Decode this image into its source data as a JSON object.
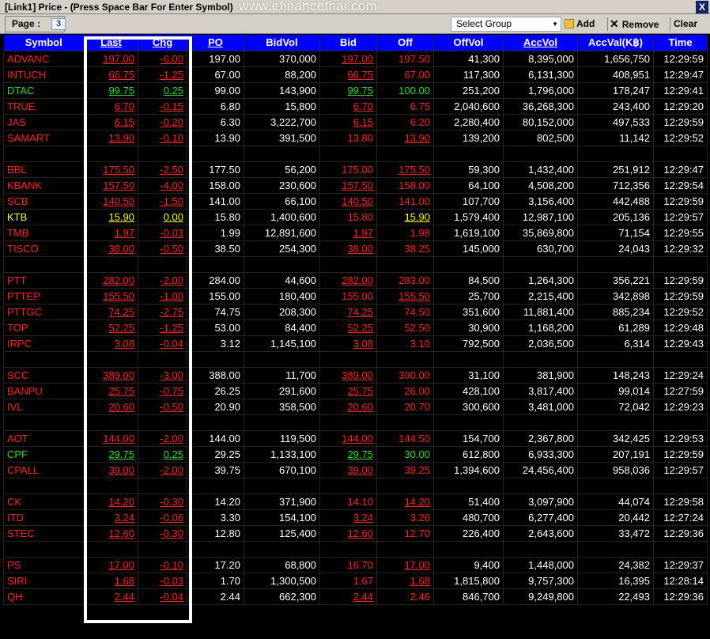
{
  "window": {
    "title": "[Link1] Price  - (Press Space Bar For Enter Symbol)",
    "watermark": "www.efinancethai.com",
    "close_label": "X"
  },
  "toolbar": {
    "page_label": "Page :",
    "page_value": "3",
    "group_placeholder": "Select Group",
    "add_label": "Add",
    "remove_label": "Remove",
    "clear_label": "Clear"
  },
  "columns": [
    "Symbol",
    "Last",
    "Chg",
    "PO",
    "BidVol",
    "Bid",
    "Off",
    "OffVol",
    "AccVol",
    "AccVal(K฿)",
    "Time"
  ],
  "rows": [
    {
      "symbol": "ADVANC",
      "c": "r",
      "last": "197.00",
      "lc": "r",
      "chg": "-6.00",
      "cc": "r",
      "po": "197.00",
      "bidvol": "370,000",
      "bid": "197.00",
      "bc": "r",
      "bu": 1,
      "off": "197.50",
      "oc": "r",
      "ou": 0,
      "offvol": "41,300",
      "accvol": "8,395,000",
      "accval": "1,656,750",
      "time": "12:29:59"
    },
    {
      "symbol": "INTUCH",
      "c": "r",
      "last": "66.75",
      "lc": "r",
      "chg": "-1.25",
      "cc": "r",
      "po": "67.00",
      "bidvol": "88,200",
      "bid": "66.75",
      "bc": "r",
      "bu": 1,
      "off": "67.00",
      "oc": "r",
      "ou": 0,
      "offvol": "117,300",
      "accvol": "6,131,300",
      "accval": "408,951",
      "time": "12:29:47"
    },
    {
      "symbol": "DTAC",
      "c": "g",
      "last": "99.75",
      "lc": "g",
      "chg": "0.25",
      "cc": "g",
      "po": "99.00",
      "bidvol": "143,900",
      "bid": "99.75",
      "bc": "g",
      "bu": 1,
      "off": "100.00",
      "oc": "g",
      "ou": 0,
      "offvol": "251,200",
      "accvol": "1,796,000",
      "accval": "178,247",
      "time": "12:29:41"
    },
    {
      "symbol": "TRUE",
      "c": "r",
      "last": "6.70",
      "lc": "r",
      "chg": "-0.15",
      "cc": "r",
      "po": "6.80",
      "bidvol": "15,800",
      "bid": "6.70",
      "bc": "r",
      "bu": 1,
      "off": "6.75",
      "oc": "r",
      "ou": 0,
      "offvol": "2,040,600",
      "accvol": "36,268,300",
      "accval": "243,400",
      "time": "12:29:20"
    },
    {
      "symbol": "JAS",
      "c": "r",
      "last": "6.15",
      "lc": "r",
      "chg": "-0.20",
      "cc": "r",
      "po": "6.30",
      "bidvol": "3,222,700",
      "bid": "6.15",
      "bc": "r",
      "bu": 1,
      "off": "6.20",
      "oc": "r",
      "ou": 0,
      "offvol": "2,280,400",
      "accvol": "80,152,000",
      "accval": "497,533",
      "time": "12:29:59"
    },
    {
      "symbol": "SAMART",
      "c": "r",
      "last": "13.90",
      "lc": "r",
      "chg": "-0.10",
      "cc": "r",
      "po": "13.90",
      "bidvol": "391,500",
      "bid": "13.80",
      "bc": "r",
      "bu": 0,
      "off": "13.90",
      "oc": "r",
      "ou": 1,
      "offvol": "139,200",
      "accvol": "802,500",
      "accval": "11,142",
      "time": "12:29:52"
    },
    {
      "blank": true
    },
    {
      "symbol": "BBL",
      "c": "r",
      "last": "175.50",
      "lc": "r",
      "chg": "-2.50",
      "cc": "r",
      "po": "177.50",
      "bidvol": "56,200",
      "bid": "175.00",
      "bc": "r",
      "bu": 0,
      "off": "175.50",
      "oc": "r",
      "ou": 1,
      "offvol": "59,300",
      "accvol": "1,432,400",
      "accval": "251,912",
      "time": "12:29:47"
    },
    {
      "symbol": "KBANK",
      "c": "r",
      "last": "157.50",
      "lc": "r",
      "chg": "-4.00",
      "cc": "r",
      "po": "158.00",
      "bidvol": "230,600",
      "bid": "157.50",
      "bc": "r",
      "bu": 1,
      "off": "158.00",
      "oc": "r",
      "ou": 0,
      "offvol": "64,100",
      "accvol": "4,508,200",
      "accval": "712,356",
      "time": "12:29:54"
    },
    {
      "symbol": "SCB",
      "c": "r",
      "last": "140.50",
      "lc": "r",
      "chg": "-1.50",
      "cc": "r",
      "po": "141.00",
      "bidvol": "66,100",
      "bid": "140.50",
      "bc": "r",
      "bu": 1,
      "off": "141.00",
      "oc": "r",
      "ou": 0,
      "offvol": "107,700",
      "accvol": "3,156,400",
      "accval": "442,488",
      "time": "12:29:59"
    },
    {
      "symbol": "KTB",
      "c": "y",
      "last": "15.90",
      "lc": "y",
      "chg": "0.00",
      "cc": "y",
      "po": "15.80",
      "bidvol": "1,400,600",
      "bid": "15.80",
      "bc": "r",
      "bu": 0,
      "off": "15.90",
      "oc": "y",
      "ou": 1,
      "offvol": "1,579,400",
      "accvol": "12,987,100",
      "accval": "205,136",
      "time": "12:29:57"
    },
    {
      "symbol": "TMB",
      "c": "r",
      "last": "1.97",
      "lc": "r",
      "chg": "-0.03",
      "cc": "r",
      "po": "1.99",
      "bidvol": "12,891,600",
      "bid": "1.97",
      "bc": "r",
      "bu": 1,
      "off": "1.98",
      "oc": "r",
      "ou": 0,
      "offvol": "1,619,100",
      "accvol": "35,869,800",
      "accval": "71,154",
      "time": "12:29:55"
    },
    {
      "symbol": "TISCO",
      "c": "r",
      "last": "38.00",
      "lc": "r",
      "chg": "-0.50",
      "cc": "r",
      "po": "38.50",
      "bidvol": "254,300",
      "bid": "38.00",
      "bc": "r",
      "bu": 1,
      "off": "38.25",
      "oc": "r",
      "ou": 0,
      "offvol": "145,000",
      "accvol": "630,700",
      "accval": "24,043",
      "time": "12:29:32"
    },
    {
      "blank": true
    },
    {
      "symbol": "PTT",
      "c": "r",
      "last": "282.00",
      "lc": "r",
      "chg": "-2.00",
      "cc": "r",
      "po": "284.00",
      "bidvol": "44,600",
      "bid": "282.00",
      "bc": "r",
      "bu": 1,
      "off": "283.00",
      "oc": "r",
      "ou": 0,
      "offvol": "84,500",
      "accvol": "1,264,300",
      "accval": "356,221",
      "time": "12:29:59"
    },
    {
      "symbol": "PTTEP",
      "c": "r",
      "last": "155.50",
      "lc": "r",
      "chg": "-1.00",
      "cc": "r",
      "po": "155.00",
      "bidvol": "180,400",
      "bid": "155.00",
      "bc": "r",
      "bu": 0,
      "off": "155.50",
      "oc": "r",
      "ou": 1,
      "offvol": "25,700",
      "accvol": "2,215,400",
      "accval": "342,898",
      "time": "12:29:59"
    },
    {
      "symbol": "PTTGC",
      "c": "r",
      "last": "74.25",
      "lc": "r",
      "chg": "-2.75",
      "cc": "r",
      "po": "74.75",
      "bidvol": "208,300",
      "bid": "74.25",
      "bc": "r",
      "bu": 1,
      "off": "74.50",
      "oc": "r",
      "ou": 0,
      "offvol": "351,600",
      "accvol": "11,881,400",
      "accval": "885,234",
      "time": "12:29:52"
    },
    {
      "symbol": "TOP",
      "c": "r",
      "last": "52.25",
      "lc": "r",
      "chg": "-1.25",
      "cc": "r",
      "po": "53.00",
      "bidvol": "84,400",
      "bid": "52.25",
      "bc": "r",
      "bu": 1,
      "off": "52.50",
      "oc": "r",
      "ou": 0,
      "offvol": "30,900",
      "accvol": "1,168,200",
      "accval": "61,289",
      "time": "12:29:48"
    },
    {
      "symbol": "IRPC",
      "c": "r",
      "last": "3.08",
      "lc": "r",
      "chg": "-0.04",
      "cc": "r",
      "po": "3.12",
      "bidvol": "1,145,100",
      "bid": "3.08",
      "bc": "r",
      "bu": 1,
      "off": "3.10",
      "oc": "r",
      "ou": 0,
      "offvol": "792,500",
      "accvol": "2,036,500",
      "accval": "6,314",
      "time": "12:29:43"
    },
    {
      "blank": true
    },
    {
      "symbol": "SCC",
      "c": "r",
      "last": "389.00",
      "lc": "r",
      "chg": "-3.00",
      "cc": "r",
      "po": "388.00",
      "bidvol": "11,700",
      "bid": "389.00",
      "bc": "r",
      "bu": 1,
      "off": "390.00",
      "oc": "r",
      "ou": 0,
      "offvol": "31,100",
      "accvol": "381,900",
      "accval": "148,243",
      "time": "12:29:24"
    },
    {
      "symbol": "BANPU",
      "c": "r",
      "last": "25.75",
      "lc": "r",
      "chg": "-0.75",
      "cc": "r",
      "po": "26.25",
      "bidvol": "291,600",
      "bid": "25.75",
      "bc": "r",
      "bu": 1,
      "off": "26.00",
      "oc": "r",
      "ou": 0,
      "offvol": "428,100",
      "accvol": "3,817,400",
      "accval": "99,014",
      "time": "12:27:59"
    },
    {
      "symbol": "IVL",
      "c": "r",
      "last": "20.60",
      "lc": "r",
      "chg": "-0.50",
      "cc": "r",
      "po": "20.90",
      "bidvol": "358,500",
      "bid": "20.60",
      "bc": "r",
      "bu": 1,
      "off": "20.70",
      "oc": "r",
      "ou": 0,
      "offvol": "300,600",
      "accvol": "3,481,000",
      "accval": "72,042",
      "time": "12:29:23"
    },
    {
      "blank": true
    },
    {
      "symbol": "AOT",
      "c": "r",
      "last": "144.00",
      "lc": "r",
      "chg": "-2.00",
      "cc": "r",
      "po": "144.00",
      "bidvol": "119,500",
      "bid": "144.00",
      "bc": "r",
      "bu": 1,
      "off": "144.50",
      "oc": "r",
      "ou": 0,
      "offvol": "154,700",
      "accvol": "2,367,800",
      "accval": "342,425",
      "time": "12:29:53"
    },
    {
      "symbol": "CPF",
      "c": "g",
      "last": "29.75",
      "lc": "g",
      "chg": "0.25",
      "cc": "g",
      "po": "29.25",
      "bidvol": "1,133,100",
      "bid": "29.75",
      "bc": "g",
      "bu": 1,
      "off": "30.00",
      "oc": "g",
      "ou": 0,
      "offvol": "612,800",
      "accvol": "6,933,300",
      "accval": "207,191",
      "time": "12:29:59"
    },
    {
      "symbol": "CPALL",
      "c": "r",
      "last": "39.00",
      "lc": "r",
      "chg": "-2.00",
      "cc": "r",
      "po": "39.75",
      "bidvol": "670,100",
      "bid": "39.00",
      "bc": "r",
      "bu": 1,
      "off": "39.25",
      "oc": "r",
      "ou": 0,
      "offvol": "1,394,600",
      "accvol": "24,456,400",
      "accval": "958,036",
      "time": "12:29:57"
    },
    {
      "blank": true
    },
    {
      "symbol": "CK",
      "c": "r",
      "last": "14.20",
      "lc": "r",
      "chg": "-0.30",
      "cc": "r",
      "po": "14.20",
      "bidvol": "371,900",
      "bid": "14.10",
      "bc": "r",
      "bu": 0,
      "off": "14.20",
      "oc": "r",
      "ou": 1,
      "offvol": "51,400",
      "accvol": "3,097,900",
      "accval": "44,074",
      "time": "12:29:58"
    },
    {
      "symbol": "ITD",
      "c": "r",
      "last": "3.24",
      "lc": "r",
      "chg": "-0.06",
      "cc": "r",
      "po": "3.30",
      "bidvol": "154,100",
      "bid": "3.24",
      "bc": "r",
      "bu": 1,
      "off": "3.26",
      "oc": "r",
      "ou": 0,
      "offvol": "480,700",
      "accvol": "6,277,400",
      "accval": "20,442",
      "time": "12:27:24"
    },
    {
      "symbol": "STEC",
      "c": "r",
      "last": "12.60",
      "lc": "r",
      "chg": "-0.30",
      "cc": "r",
      "po": "12.80",
      "bidvol": "125,400",
      "bid": "12.60",
      "bc": "r",
      "bu": 1,
      "off": "12.70",
      "oc": "r",
      "ou": 0,
      "offvol": "226,400",
      "accvol": "2,643,600",
      "accval": "33,472",
      "time": "12:29:36"
    },
    {
      "blank": true
    },
    {
      "symbol": "PS",
      "c": "r",
      "last": "17.00",
      "lc": "r",
      "chg": "-0.10",
      "cc": "r",
      "po": "17.20",
      "bidvol": "68,800",
      "bid": "16.70",
      "bc": "r",
      "bu": 0,
      "off": "17.00",
      "oc": "r",
      "ou": 1,
      "offvol": "9,400",
      "accvol": "1,448,000",
      "accval": "24,382",
      "time": "12:29:37"
    },
    {
      "symbol": "SIRI",
      "c": "r",
      "last": "1.68",
      "lc": "r",
      "chg": "-0.03",
      "cc": "r",
      "po": "1.70",
      "bidvol": "1,300,500",
      "bid": "1.67",
      "bc": "r",
      "bu": 0,
      "off": "1.68",
      "oc": "r",
      "ou": 1,
      "offvol": "1,815,800",
      "accvol": "9,757,300",
      "accval": "16,395",
      "time": "12:28:14"
    },
    {
      "symbol": "QH",
      "c": "r",
      "last": "2.44",
      "lc": "r",
      "chg": "-0.04",
      "cc": "r",
      "po": "2.44",
      "bidvol": "662,300",
      "bid": "2.44",
      "bc": "r",
      "bu": 1,
      "off": "2.46",
      "oc": "r",
      "ou": 0,
      "offvol": "846,700",
      "accvol": "9,249,800",
      "accval": "22,493",
      "time": "12:29:36"
    }
  ],
  "colors": {
    "header_bg": "#0000ff",
    "down": "#ff2020",
    "up": "#20e020",
    "unchanged": "#ffff00",
    "background": "#000000"
  }
}
